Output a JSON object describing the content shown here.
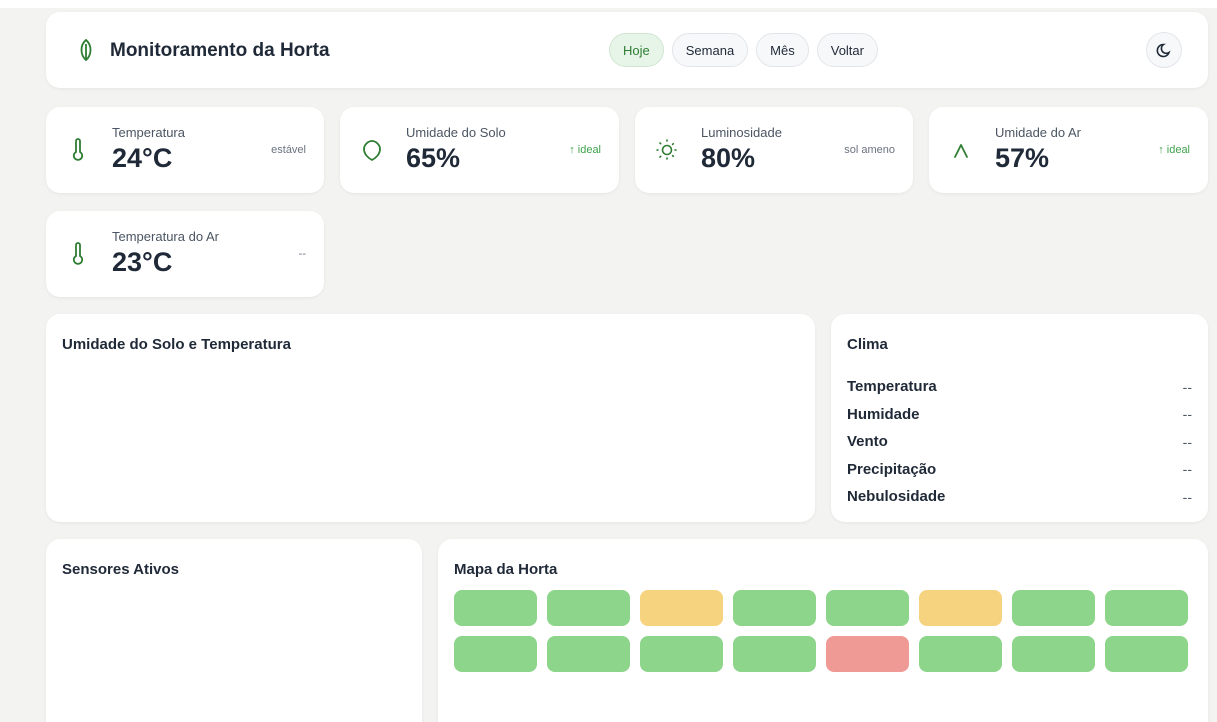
{
  "header": {
    "title": "Monitoramento da Horta",
    "nav": [
      {
        "label": "Hoje",
        "active": true
      },
      {
        "label": "Semana",
        "active": false
      },
      {
        "label": "Mês",
        "active": false
      },
      {
        "label": "Voltar",
        "active": false
      }
    ],
    "logo_icon": "leaf-icon",
    "theme_icon": "moon-icon"
  },
  "metrics": [
    {
      "label": "Temperatura",
      "value": "24°C",
      "status": "estável",
      "icon": "thermometer-icon"
    },
    {
      "label": "Umidade do Solo",
      "value": "65%",
      "status": "↑ ideal",
      "icon": "droplet-icon"
    },
    {
      "label": "Luminosidade",
      "value": "80%",
      "status": "sol ameno",
      "icon": "sun-icon"
    },
    {
      "label": "Umidade do Ar",
      "value": "57%",
      "status": "↑ ideal",
      "icon": "wind-icon"
    },
    {
      "label": "Temperatura do Ar",
      "value": "23°C",
      "status": "--",
      "icon": "thermometer-icon"
    }
  ],
  "chart_panel": {
    "title": "Umidade do Solo e Temperatura"
  },
  "clima": {
    "title": "Clima",
    "rows": [
      {
        "label": "Temperatura",
        "value": "--"
      },
      {
        "label": "Humidade",
        "value": "--"
      },
      {
        "label": "Vento",
        "value": "--"
      },
      {
        "label": "Precipitação",
        "value": "--"
      },
      {
        "label": "Nebulosidade",
        "value": "--"
      }
    ]
  },
  "sensors": {
    "title": "Sensores Ativos"
  },
  "map": {
    "title": "Mapa da Horta",
    "plots": [
      "ok",
      "ok",
      "warn",
      "ok",
      "ok",
      "warn",
      "ok",
      "ok",
      "ok",
      "ok",
      "ok",
      "ok",
      "alert",
      "ok",
      "ok",
      "ok"
    ]
  },
  "colors": {
    "accent": "#2e7d32",
    "ok": "#8dd58a",
    "warn": "#f6d37f",
    "alert": "#f09a96",
    "status_up": "#3fa34d"
  }
}
